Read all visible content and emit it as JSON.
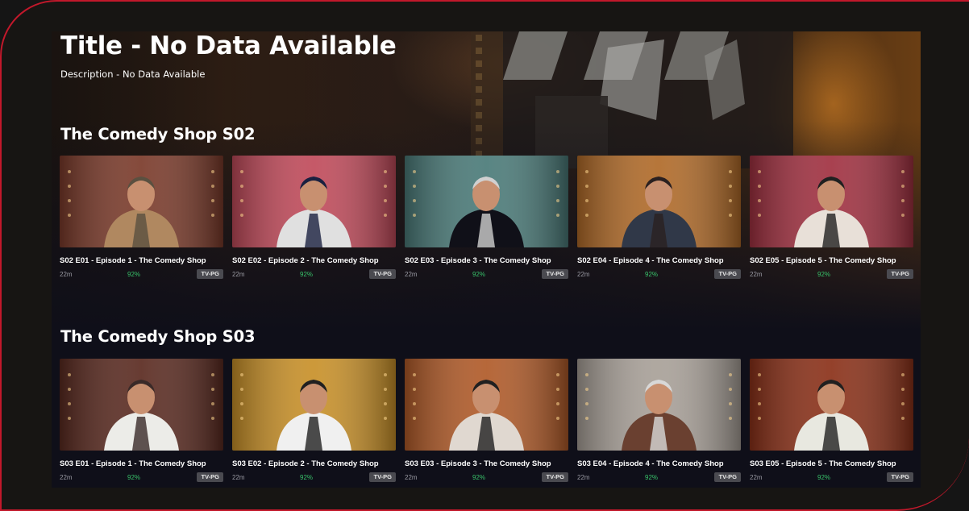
{
  "hero": {
    "title": "Title - No Data Available",
    "description": "Description - No Data Available"
  },
  "rows": [
    {
      "title": "The Comedy Shop S02",
      "episodes": [
        {
          "title": "S02 E01 - Episode 1 - The Comedy Shop",
          "duration": "22m",
          "score": "92%",
          "rating": "TV-PG",
          "palette": [
            "#7a3a2a",
            "#b08860",
            "#5a5040"
          ]
        },
        {
          "title": "S02 E02 - Episode 2 - The Comedy Shop",
          "duration": "22m",
          "score": "92%",
          "rating": "TV-PG",
          "palette": [
            "#c04a5a",
            "#e0e0e0",
            "#1a2040"
          ]
        },
        {
          "title": "S02 E03 - Episode 3 - The Comedy Shop",
          "duration": "22m",
          "score": "92%",
          "rating": "TV-PG",
          "palette": [
            "#4a7a78",
            "#101018",
            "#d0d0d0"
          ]
        },
        {
          "title": "S02 E04 - Episode 4 - The Comedy Shop",
          "duration": "22m",
          "score": "92%",
          "rating": "TV-PG",
          "palette": [
            "#b06a28",
            "#303848",
            "#2a2020"
          ]
        },
        {
          "title": "S02 E05 - Episode 5 - The Comedy Shop",
          "duration": "22m",
          "score": "92%",
          "rating": "TV-PG",
          "palette": [
            "#a03040",
            "#e8e0d8",
            "#202020"
          ]
        }
      ]
    },
    {
      "title": "The Comedy Shop S03",
      "episodes": [
        {
          "title": "S03 E01 - Episode 1 - The Comedy Shop",
          "duration": "22m",
          "score": "92%",
          "rating": "TV-PG",
          "palette": [
            "#5a2a20",
            "#ecece8",
            "#3a2a28"
          ]
        },
        {
          "title": "S03 E02 - Episode 2 - The Comedy Shop",
          "duration": "22m",
          "score": "92%",
          "rating": "TV-PG",
          "palette": [
            "#c89028",
            "#f0f0f0",
            "#202020"
          ]
        },
        {
          "title": "S03 E03 - Episode 3 - The Comedy Shop",
          "duration": "22m",
          "score": "92%",
          "rating": "TV-PG",
          "palette": [
            "#b05a28",
            "#e0d8d0",
            "#202020"
          ]
        },
        {
          "title": "S03 E04 - Episode 4 - The Comedy Shop",
          "duration": "22m",
          "score": "92%",
          "rating": "TV-PG",
          "palette": [
            "#a8a098",
            "#6a4030",
            "#d8d8d8"
          ]
        },
        {
          "title": "S03 E05 - Episode 5 - The Comedy Shop",
          "duration": "22m",
          "score": "92%",
          "rating": "TV-PG",
          "palette": [
            "#8a3018",
            "#e8e8e0",
            "#202020"
          ]
        }
      ]
    }
  ],
  "colors": {
    "frame": "#c2182b",
    "score": "#38c26a",
    "rating_bg": "#4a4a50"
  }
}
